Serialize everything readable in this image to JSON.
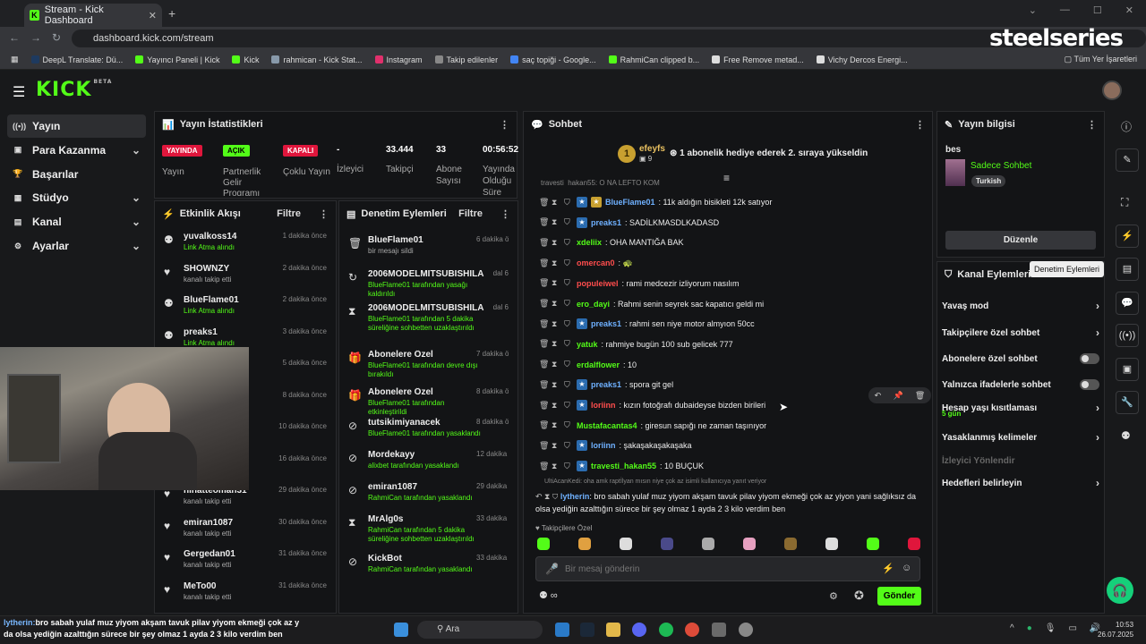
{
  "browser": {
    "tab_title": "Stream - Kick Dashboard",
    "url": "dashboard.kick.com/stream",
    "overlay_logo": "steelseries",
    "bookmarks": [
      "DeepL Translate: Dü...",
      "Yayıncı Paneli | Kick",
      "Kick",
      "rahmican - Kick Stat...",
      "Instagram",
      "Takip edilenler",
      "saç topiği - Google...",
      "RahmiCan clipped b...",
      "Free Remove metad...",
      "Vichy Dercos Energi..."
    ],
    "all_bookmarks": "Tüm Yer İşaretleri"
  },
  "sidebar": {
    "items": [
      {
        "label": "Yayın",
        "icon": "broadcast-icon",
        "chev": ""
      },
      {
        "label": "Para Kazanma",
        "icon": "wallet-icon",
        "chev": "⌄"
      },
      {
        "label": "Başarılar",
        "icon": "trophy-icon",
        "chev": ""
      },
      {
        "label": "Stüdyo",
        "icon": "studio-icon",
        "chev": "⌄"
      },
      {
        "label": "Kanal",
        "icon": "channel-icon",
        "chev": "⌄"
      },
      {
        "label": "Ayarlar",
        "icon": "gear-icon",
        "chev": "⌄"
      }
    ]
  },
  "stats": {
    "title": "Yayın İstatistikleri",
    "items": [
      {
        "badge": "YAYINDA",
        "label": "Yayın",
        "color": "#e0163c"
      },
      {
        "badge": "AÇIK",
        "label": "Partnerlik Gelir Programı",
        "color": "#53fc18"
      },
      {
        "badge": "KAPALI",
        "label": "Çoklu Yayın",
        "color": "#e0163c"
      }
    ],
    "values": [
      {
        "value": "-",
        "label": "İzleyici"
      },
      {
        "value": "33.444",
        "label": "Takipçi"
      },
      {
        "value": "33",
        "label": "Abone Sayısı"
      },
      {
        "value": "00:56:52",
        "label": "Yayında Olduğu Süre"
      }
    ]
  },
  "activity": {
    "title": "Etkinlik Akışı",
    "filter": "Filtre",
    "items": [
      {
        "name": "yuvalkoss14",
        "sub": "Link Atma alındı",
        "time": "1 dakika önce"
      },
      {
        "name": "SHOWNZY",
        "sub": "kanalı takip etti",
        "time": "2 dakika önce"
      },
      {
        "name": "BlueFlame01",
        "sub": "Link Atma alındı",
        "time": "2 dakika önce"
      },
      {
        "name": "preaks1",
        "sub": "Link Atma alındı",
        "time": "3 dakika önce"
      },
      {
        "name": "",
        "sub": "",
        "time": "5 dakika önce"
      },
      {
        "name": "",
        "sub": "",
        "time": "8 dakika önce"
      },
      {
        "name": "k",
        "sub": "",
        "time": "10 dakika önce"
      },
      {
        "name": "",
        "sub": "",
        "time": "16 dakika önce"
      },
      {
        "name": "nihatteoman31",
        "sub": "kanalı takip etti",
        "time": "29 dakika önce"
      },
      {
        "name": "emiran1087",
        "sub": "kanalı takip etti",
        "time": "30 dakika önce"
      },
      {
        "name": "Gergedan01",
        "sub": "kanalı takip etti",
        "time": "31 dakika önce"
      },
      {
        "name": "MeTo00",
        "sub": "kanalı takip etti",
        "time": "31 dakika önce"
      }
    ]
  },
  "moderation": {
    "title": "Denetim Eylemleri",
    "filter": "Filtre",
    "items": [
      {
        "name": "BlueFlame01",
        "sub": "bir mesajı sildi",
        "time": "6 dakika önce"
      },
      {
        "name": "2006MODELMITSUBISHILANCER",
        "sub": "BlueFlame01 tarafından yasağı kaldırıldı",
        "time": "dal 6"
      },
      {
        "name": "2006MODELMITSUBISHILANCER",
        "sub": "BlueFlame01 tarafından 5 dakika süreliğine sohbetten uzaklaştırıldı",
        "time": "dal 6"
      },
      {
        "name": "Abonelere Özel",
        "sub": "BlueFlame01 tarafından devre dışı bırakıldı",
        "time": "7 dakika önce"
      },
      {
        "name": "Abonelere Özel",
        "sub": "BlueFlame01 tarafından etkinleştirildi",
        "time": "8 dakika önce"
      },
      {
        "name": "tutsikimiyanacek",
        "sub": "BlueFlame01 tarafından yasaklandı",
        "time": "8 dakika önce"
      },
      {
        "name": "Mordekayy",
        "sub": "alixbet tarafından yasaklandı",
        "time": "12 dakika önce"
      },
      {
        "name": "emiran1087",
        "sub": "RahmiCan tarafından yasaklandı",
        "time": "29 dakika önce"
      },
      {
        "name": "MrAlg0s",
        "sub": "RahmiCan tarafından 5 dakika süreliğine sohbetten uzaklaştırıldı",
        "time": "33 dakika önce"
      },
      {
        "name": "KickBot",
        "sub": "RahmiCan tarafından yasaklandı",
        "time": "33 dakika önce"
      }
    ]
  },
  "chat": {
    "title": "Sohbet",
    "gifter": "efeyfs",
    "gifter_count": "9",
    "gift_rank": "1",
    "gift_text": "1 abonelik hediye ederek 2. sıraya yükseldin",
    "pinned_partial": "travesti_hakan55: O NA LEFTO KOM",
    "messages": [
      {
        "user": "BlueFlame01",
        "text": ": 11k aldığın bisikleti 12k satıyor",
        "color": "#6fb1ff"
      },
      {
        "user": "preaks1",
        "text": ": SADİLKMASDLKADASD",
        "color": "#6fb1ff"
      },
      {
        "user": "xdeliix",
        "text": ": OHA MANTIĞA BAK",
        "color": "#53fc18"
      },
      {
        "user": "omercan0",
        "text": ": 🐢",
        "color": "#ff4d4d"
      },
      {
        "user": "populeiwel",
        "text": ": rami medcezir izliyorum nasılım",
        "color": "#ff4d4d"
      },
      {
        "user": "ero_dayi",
        "text": ": Rahmi senin seyrek sac kapatıcı geldi mi",
        "color": "#53fc18"
      },
      {
        "user": "preaks1",
        "text": ": rahmi sen niye motor almyıon 50cc",
        "color": "#6fb1ff"
      },
      {
        "user": "yatuk",
        "text": ": rahmiye bugün 100 sub gelicek 777",
        "color": "#53fc18"
      },
      {
        "user": "erdalflower",
        "text": ": 10",
        "color": "#53fc18"
      },
      {
        "user": "preaks1",
        "text": ": spora git gel",
        "color": "#6fb1ff"
      },
      {
        "user": "loriinn",
        "text": ": kızın fotoğrafı dubaideyse bizden birileri",
        "color": "#ff4d4d"
      },
      {
        "user": "Mustafacantas4",
        "text": ": giresun sapığı ne zaman taşınıyor",
        "color": "#53fc18"
      },
      {
        "user": "loriinn",
        "text": ": şakaşakaşakaşaka",
        "color": "#6fb1ff"
      },
      {
        "user": "travesti_hakan55",
        "text": ": 10 BUÇUK",
        "color": "#53fc18"
      }
    ],
    "reply_hint": "UltiAcanKedi: oha amk raptİlyan mısın niye çok az isimli kullanıcıya yanıt veriyor",
    "long_user": "lytherin",
    "long_text": ": bro sabah yulaf muz yiyom akşam tavuk pilav yiyom ekmeği çok az yiyon yani sağlıksız da olsa yediğin azalttığın sürece bir şey olmaz 1 ayda 2 3 kilo verdim ben",
    "emote_section": "Takipçilere Özel",
    "input_placeholder": "Bir mesaj gönderin",
    "send": "Gönder"
  },
  "streaminfo": {
    "title": "Yayın bilgisi",
    "stream_title": "bes",
    "category": "Sadece Sohbet",
    "tag": "Turkish",
    "edit": "Düzenle"
  },
  "channel_actions": {
    "title": "Kanal Eylemleri",
    "tooltip": "Denetim Eylemleri",
    "items": [
      {
        "label": "Yavaş mod",
        "kind": "chev"
      },
      {
        "label": "Takipçilere özel sohbet",
        "kind": "chev"
      },
      {
        "label": "Abonelere özel sohbet",
        "kind": "toggle"
      },
      {
        "label": "Yalnızca ifadelerle sohbet",
        "kind": "toggle"
      },
      {
        "label": "Hesap yaşı kısıtlaması",
        "kind": "chev",
        "sub": "5 gün"
      },
      {
        "label": "Yasaklanmış kelimeler",
        "kind": "chev"
      },
      {
        "label": "İzleyici Yönlendir",
        "kind": "disabled"
      },
      {
        "label": "Hedefleri belirleyin",
        "kind": "chev"
      }
    ]
  },
  "caption": {
    "user": "lytherin:",
    "line1": "bro sabah yulaf muz yiyom akşam tavuk pilav yiyom ekmeği çok az y",
    "line2": "da olsa yediğin azalttığın sürece bir şey olmaz 1 ayda 2 3 kilo verdim ben"
  },
  "taskbar": {
    "search": "Ara",
    "time": "10:53",
    "date": "26.07.2025"
  }
}
